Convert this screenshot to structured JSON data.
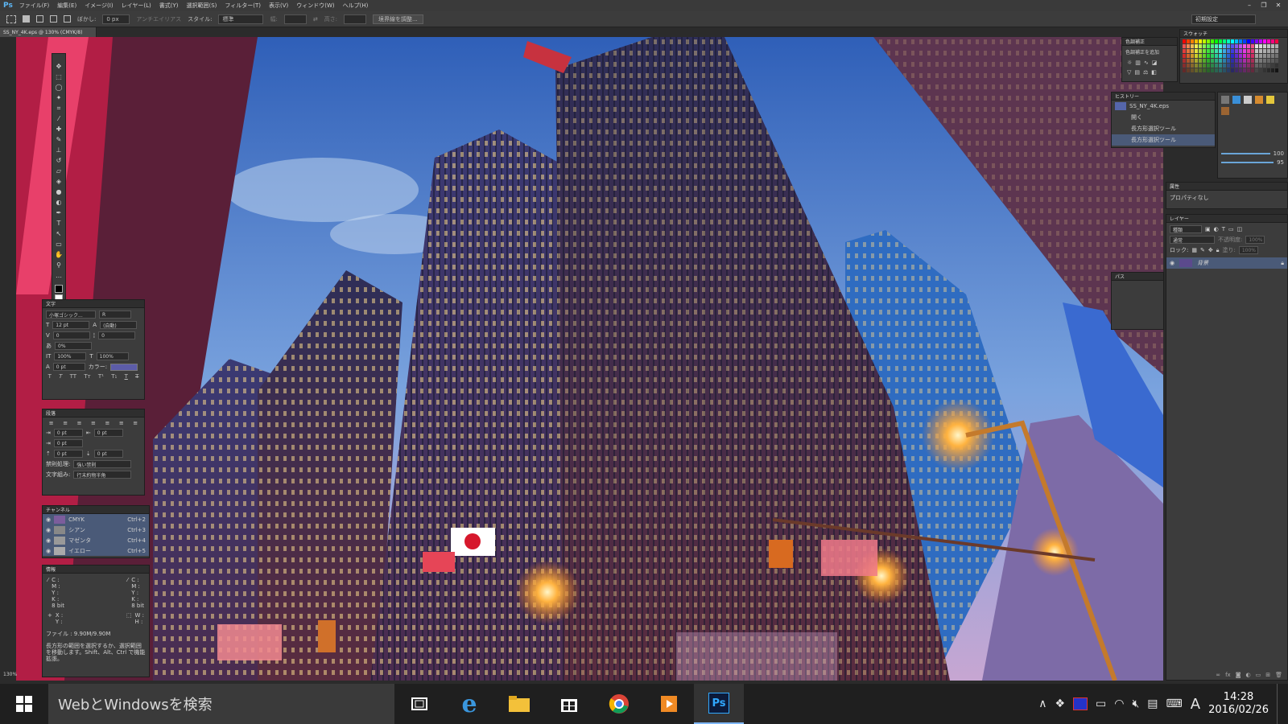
{
  "app": {
    "logo": "Ps"
  },
  "menu": [
    "ファイル(F)",
    "編集(E)",
    "イメージ(I)",
    "レイヤー(L)",
    "書式(Y)",
    "選択範囲(S)",
    "フィルター(T)",
    "表示(V)",
    "ウィンドウ(W)",
    "ヘルプ(H)"
  ],
  "options": {
    "feather_label": "ぼかし:",
    "feather_value": "0 px",
    "antialias": "アンチエイリアス",
    "style_label": "スタイル:",
    "style_value": "標準",
    "width_label": "幅:",
    "height_label": "高さ:",
    "refine": "境界線を調整...",
    "workspace": "初期設定"
  },
  "document": {
    "tab": "SS_NY_4K.eps @ 130% (CMYK/8)",
    "zoom": "130%"
  },
  "character": {
    "title": "文字",
    "font": "小塚ゴシック...",
    "style": "R",
    "size": "12 pt",
    "leading": "(自動)",
    "kerning": "0",
    "tracking": "0",
    "scale_pct": "0%",
    "vscale": "100%",
    "hscale": "100%",
    "baseline": "0 pt",
    "color_label": "カラー:",
    "color": "#5c5ca8"
  },
  "paragraph": {
    "title": "段落",
    "indent_left": "0 pt",
    "indent_right": "0 pt",
    "first_line": "0 pt",
    "space_before": "0 pt",
    "space_after": "0 pt",
    "kinsoku_label": "禁則処理:",
    "kinsoku_value": "強い禁則",
    "mojikumi_label": "文字組み:",
    "mojikumi_value": "行末約物半角"
  },
  "channels": {
    "title": "チャンネル",
    "items": [
      {
        "name": "CMYK",
        "shortcut": "Ctrl+2"
      },
      {
        "name": "シアン",
        "shortcut": "Ctrl+3"
      },
      {
        "name": "マゼンタ",
        "shortcut": "Ctrl+4"
      },
      {
        "name": "イエロー",
        "shortcut": "Ctrl+5"
      }
    ]
  },
  "info": {
    "title": "情報",
    "left_labels": "C :\nM :\nY :\nK :\n8 bit",
    "right_labels": "C :\nM :\nY :\nK :\n8 bit",
    "xy": "X :\nY :",
    "wh": "W :\nH :",
    "file": "ファイル : 9.90M/9.90M",
    "hint": "長方形の範囲を選択するか、選択範囲を移動します。Shift、Alt、Ctrl で機能拡張。"
  },
  "adjustments": {
    "title": "色調補正",
    "subtitle": "色調補正を追加"
  },
  "swatches": {
    "title": "スウォッチ"
  },
  "history": {
    "title": "ヒストリー",
    "snapshot": "SS_NY_4K.eps",
    "items": [
      "開く",
      "長方形選択ツール",
      "長方形選択ツール"
    ]
  },
  "properties": {
    "title": "属性",
    "text": "プロパティなし"
  },
  "layers": {
    "title": "レイヤー",
    "kind": "種類",
    "blend": "通常",
    "opacity_label": "不透明度:",
    "opacity": "100%",
    "lock_label": "ロック:",
    "fill_label": "塗り:",
    "fill": "100%",
    "layer_name": "背景"
  },
  "paths": {
    "title": "パス"
  },
  "sliders": {
    "a": "100",
    "b": "95"
  },
  "taskbar": {
    "search": "WebとWindowsを検索",
    "ime": "A",
    "time": "14:28",
    "date": "2016/02/26"
  }
}
